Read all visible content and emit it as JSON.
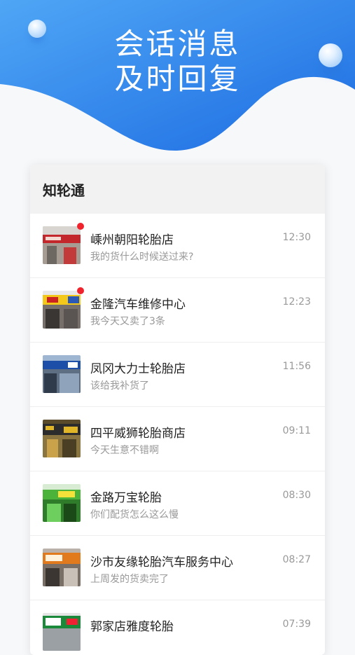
{
  "hero": {
    "line1": "会话消息",
    "line2": "及时回复"
  },
  "card": {
    "title": "知轮通"
  },
  "conversations": [
    {
      "name": "嵊州朝阳轮胎店",
      "message": "我的货什么时候送过来?",
      "time": "12:30",
      "unread": true
    },
    {
      "name": "金隆汽车维修中心",
      "message": "我今天又卖了3条",
      "time": "12:23",
      "unread": true
    },
    {
      "name": "凤冈大力士轮胎店",
      "message": "该给我补货了",
      "time": "11:56",
      "unread": false
    },
    {
      "name": "四平威狮轮胎商店",
      "message": "今天生意不错啊",
      "time": "09:11",
      "unread": false
    },
    {
      "name": "金路万宝轮胎",
      "message": "你们配货怎么这么慢",
      "time": "08:30",
      "unread": false
    },
    {
      "name": "沙市友缘轮胎汽车服务中心",
      "message": "上周发的货卖完了",
      "time": "08:27",
      "unread": false
    },
    {
      "name": "郭家店雅度轮胎",
      "message": "",
      "time": "07:39",
      "unread": false
    }
  ],
  "colors": {
    "hero_top": "#4aa3f5",
    "hero_bottom": "#1f6fe4",
    "unread_dot": "#f0222b"
  }
}
